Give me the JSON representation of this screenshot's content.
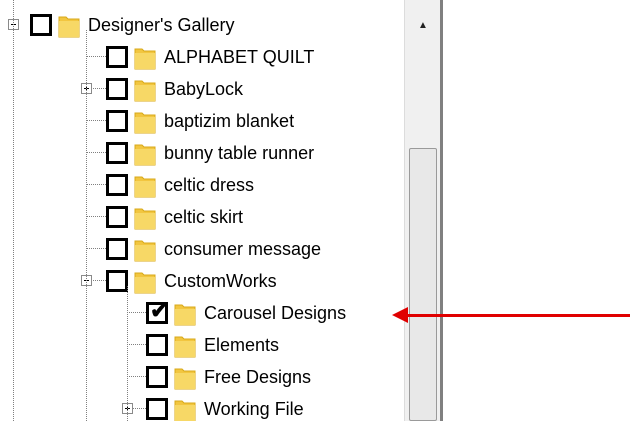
{
  "tree": {
    "items": [
      {
        "label": "Designer's Gallery",
        "level": 0,
        "expander": "minus",
        "checked": false
      },
      {
        "label": "ALPHABET QUILT",
        "level": 1,
        "expander": "",
        "checked": false
      },
      {
        "label": "BabyLock",
        "level": 1,
        "expander": "plus",
        "checked": false
      },
      {
        "label": "baptizim blanket",
        "level": 1,
        "expander": "",
        "checked": false
      },
      {
        "label": "bunny table runner",
        "level": 1,
        "expander": "",
        "checked": false
      },
      {
        "label": "celtic dress",
        "level": 1,
        "expander": "",
        "checked": false
      },
      {
        "label": "celtic skirt",
        "level": 1,
        "expander": "",
        "checked": false
      },
      {
        "label": "consumer message",
        "level": 1,
        "expander": "",
        "checked": false
      },
      {
        "label": "CustomWorks",
        "level": 1,
        "expander": "minus",
        "checked": false
      },
      {
        "label": "Carousel Designs",
        "level": 2,
        "expander": "",
        "checked": true
      },
      {
        "label": "Elements",
        "level": 2,
        "expander": "",
        "checked": false
      },
      {
        "label": "Free Designs",
        "level": 2,
        "expander": "",
        "checked": false
      },
      {
        "label": "Working File",
        "level": 2,
        "expander": "plus",
        "checked": false
      }
    ]
  },
  "icons": {
    "folder": "folder-icon",
    "check": "checkmark-icon",
    "scroll_up": "scroll-up-arrow-icon",
    "pointer": "red-arrow-icon"
  },
  "colors": {
    "arrow": "#e00000",
    "folder": "#f2c640",
    "scrollbar": "#f0f0f0"
  }
}
